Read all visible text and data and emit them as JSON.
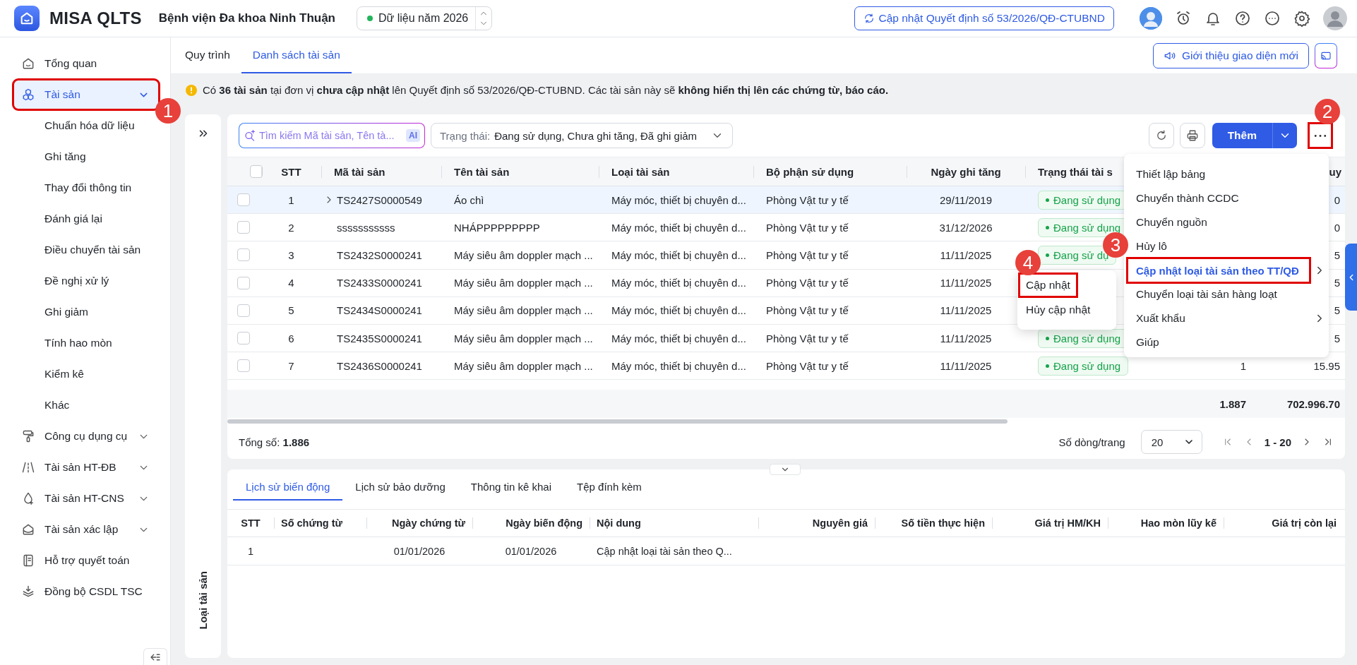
{
  "header": {
    "app_name": "MISA QLTS",
    "organization": "Bệnh viện Đa khoa Ninh Thuận",
    "year_selector": "Dữ liệu năm 2026",
    "update_button": "Cập nhật Quyết định số 53/2026/QĐ-CTUBND"
  },
  "sidebar": {
    "items": [
      {
        "label": "Tổng quan",
        "selected": false
      },
      {
        "label": "Tài sản",
        "selected": true,
        "expanded": true,
        "callout": "1",
        "children": [
          {
            "label": "Chuẩn hóa dữ liệu",
            "selected": false
          },
          {
            "label": "Ghi tăng",
            "selected": false
          },
          {
            "label": "Thay đổi thông tin",
            "selected": false
          },
          {
            "label": "Đánh giá lại",
            "selected": false
          },
          {
            "label": "Điều chuyển tài sản",
            "selected": false
          },
          {
            "label": "Đề nghị xử lý",
            "selected": false
          },
          {
            "label": "Ghi giảm",
            "selected": false
          },
          {
            "label": "Tính hao mòn",
            "selected": false
          },
          {
            "label": "Kiểm kê",
            "selected": false
          },
          {
            "label": "Khác",
            "selected": false
          }
        ]
      },
      {
        "label": "Công cụ dụng cụ",
        "selected": false,
        "expanded": false
      },
      {
        "label": "Tài sản HT-ĐB",
        "selected": false,
        "expanded": false
      },
      {
        "label": "Tài sản HT-CNS",
        "selected": false,
        "expanded": false
      },
      {
        "label": "Tài sản xác lập",
        "selected": false,
        "expanded": false
      },
      {
        "label": "Hỗ trợ quyết toán",
        "selected": false
      },
      {
        "label": "Đồng bộ CSDL TSC",
        "selected": false
      }
    ]
  },
  "page_tabs": [
    {
      "label": "Quy trình",
      "selected": false
    },
    {
      "label": "Danh sách tài sản",
      "selected": true
    }
  ],
  "intro_button": "Giới thiệu giao diện mới",
  "notice": "Có **36 tài sản** tại đơn vị **chưa cập nhật** lên Quyết định số 53/2026/QĐ-CTUBND. Các tài sản này sẽ **không hiển thị lên các chứng từ, báo cáo.**",
  "side_panel": {
    "title": "Loại tài sản"
  },
  "toolbar": {
    "search": {
      "placeholder": "Tìm kiếm Mã tài sản, Tên tà...",
      "ai_badge": "AI"
    },
    "status_filter": {
      "label": "Trạng thái:",
      "value": "Đang sử dụng, Chưa ghi tăng, Đã ghi giảm"
    },
    "add_button": "Thêm",
    "more_button": {
      "callout": "2"
    }
  },
  "table": {
    "all_checked": false,
    "columns": [
      "STT",
      "Mã tài sản",
      "Tên tài sản",
      "Loại tài sản",
      "Bộ phận sử dụng",
      "Ngày ghi tăng",
      "Trạng thái tài s"
    ],
    "column_10_heading": "uy",
    "rows": [
      {
        "checked": false,
        "selected": true,
        "expandable": true,
        "stt": "1",
        "code": "TS2427S0000549",
        "name": "Áo chì",
        "type": "Máy móc, thiết bị chuyên d...",
        "department": "Phòng Vật tư y tế",
        "date": "29/11/2019",
        "status": "Đang sử dụng",
        "column_10": "0"
      },
      {
        "checked": false,
        "selected": false,
        "expandable": false,
        "stt": "2",
        "code": "sssssssssss",
        "name": "NHÁPPPPPPPPP",
        "type": "Máy móc, thiết bị chuyên d...",
        "department": "Phòng Vật tư y tế",
        "date": "31/12/2026",
        "status": "Đang sử dụng",
        "column_10": "0"
      },
      {
        "checked": false,
        "selected": false,
        "expandable": false,
        "stt": "3",
        "code": "TS2432S0000241",
        "name": "Máy siêu âm doppler mạch ...",
        "type": "Máy móc, thiết bị chuyên d...",
        "department": "Phòng Vật tư y tế",
        "date": "11/11/2025",
        "status": "Đang sử dụ",
        "column_10": "5"
      },
      {
        "checked": false,
        "selected": false,
        "expandable": false,
        "stt": "4",
        "code": "TS2433S0000241",
        "name": "Máy siêu âm doppler mạch ...",
        "type": "Máy móc, thiết bị chuyên d...",
        "department": "Phòng Vật tư y tế",
        "date": "11/11/2025",
        "column_10": "5"
      },
      {
        "checked": false,
        "selected": false,
        "expandable": false,
        "stt": "5",
        "code": "TS2434S0000241",
        "name": "Máy siêu âm doppler mạch ...",
        "type": "Máy móc, thiết bị chuyên d...",
        "department": "Phòng Vật tư y tế",
        "date": "11/11/2025",
        "column_10": "5"
      },
      {
        "checked": false,
        "selected": false,
        "expandable": false,
        "stt": "6",
        "code": "TS2435S0000241",
        "name": "Máy siêu âm doppler mạch ...",
        "type": "Máy móc, thiết bị chuyên d...",
        "department": "Phòng Vật tư y tế",
        "date": "11/11/2025",
        "status": "Đang sử dụng",
        "column_10": "5"
      },
      {
        "checked": false,
        "selected": false,
        "expandable": false,
        "stt": "7",
        "code": "TS2436S0000241",
        "name": "Máy siêu âm doppler mạch ...",
        "type": "Máy móc, thiết bị chuyên d...",
        "department": "Phòng Vật tư y tế",
        "date": "11/11/2025",
        "status": "Đang sử dụng",
        "column_9": "1",
        "column_10": "15.95"
      }
    ],
    "summary": {
      "column_9": "1.887",
      "column_10": "702.996.70"
    }
  },
  "footer": {
    "total": "Tổng số: **1.886**",
    "page_size_label": "Số dòng/trang",
    "page_size": "20",
    "range": "1 - 20"
  },
  "more_menu": {
    "items": [
      {
        "label": "Thiết lập bảng",
        "selected": false,
        "has_submenu": false
      },
      {
        "label": "Chuyển thành CCDC",
        "selected": false,
        "has_submenu": false
      },
      {
        "label": "Chuyển nguồn",
        "selected": false,
        "has_submenu": false
      },
      {
        "label": "Hủy lô",
        "selected": false,
        "has_submenu": false
      },
      {
        "label": "Cập nhật loại tài sản theo TT/QĐ",
        "selected": true,
        "has_submenu": true,
        "callout": "3"
      },
      {
        "label": "Chuyển loại tài sản hàng loạt",
        "selected": false,
        "has_submenu": false
      },
      {
        "label": "Xuất khẩu",
        "selected": false,
        "has_submenu": true
      },
      {
        "label": "Giúp",
        "selected": false,
        "has_submenu": false
      }
    ],
    "submenu": [
      {
        "label": "Cập nhật",
        "callout": "4"
      },
      {
        "label": "Hủy cập nhật"
      }
    ]
  },
  "history": {
    "tabs": [
      {
        "label": "Lịch sử biến động",
        "selected": true
      },
      {
        "label": "Lịch sử bảo dưỡng",
        "selected": false
      },
      {
        "label": "Thông tin kê khai",
        "selected": false
      },
      {
        "label": "Tệp đính kèm",
        "selected": false
      }
    ],
    "columns": [
      "STT",
      "Số chứng từ",
      "Ngày chứng từ",
      "Ngày biến động",
      "Nội dung",
      "Nguyên giá",
      "Số tiền thực hiện",
      "Giá trị HM/KH",
      "Hao mòn lũy kế",
      "Giá trị còn lại"
    ],
    "rows": [
      {
        "stt": "1",
        "document_date": "01/01/2026",
        "change_date": "01/01/2026",
        "content": "Cập nhật loại tài sản theo Q..."
      }
    ]
  }
}
